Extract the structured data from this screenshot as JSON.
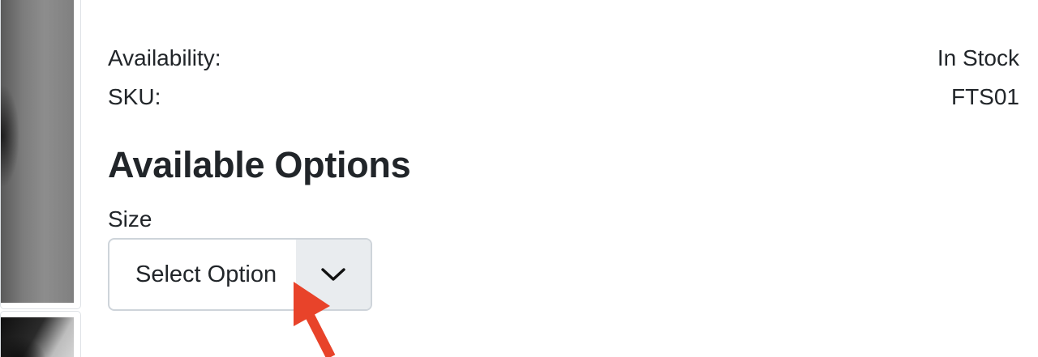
{
  "details": {
    "availability_label": "Availability:",
    "availability_value": "In Stock",
    "sku_label": "SKU:",
    "sku_value": "FTS01"
  },
  "options": {
    "title": "Available Options",
    "size_label": "Size",
    "size_select_value": "Select Option"
  },
  "icons": {
    "dropdown": "chevron-down-icon",
    "annotation": "red-arrow-icon"
  },
  "colors": {
    "text": "#212529",
    "select_border": "#ced4da",
    "select_button_bg": "#e9ecef",
    "annotation_arrow": "#e8432a"
  }
}
